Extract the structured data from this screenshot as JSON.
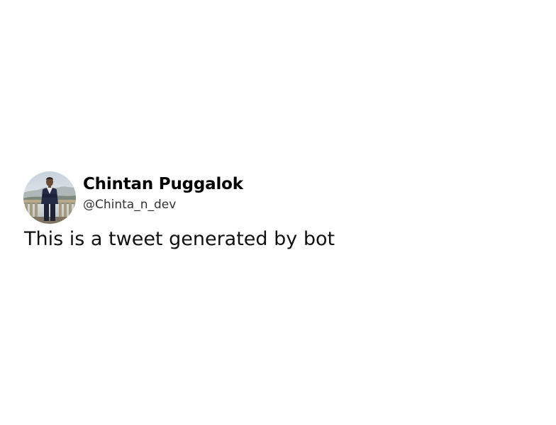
{
  "tweet": {
    "author": {
      "display_name": "Chintan Puggalok",
      "handle": "@Chinta_n_dev",
      "avatar": "profile-photo"
    },
    "text": "This is a tweet generated by bot"
  }
}
